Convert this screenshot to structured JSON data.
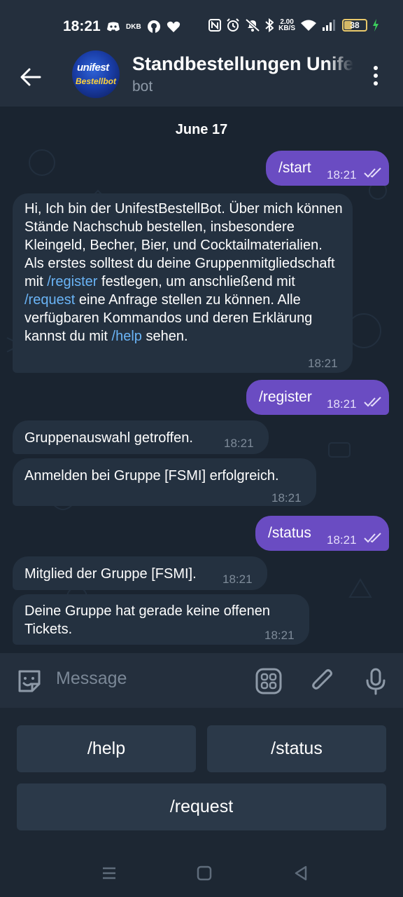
{
  "status_bar": {
    "time": "18:21",
    "carrier_label": "DKB",
    "net_speed_value": "2.00",
    "net_speed_unit": "KB/S",
    "battery": "38"
  },
  "header": {
    "title": "Standbestellungen Unifest",
    "subtitle": "bot",
    "avatar_text_top": "unifest",
    "avatar_text_bottom": "Bestellbot"
  },
  "chat": {
    "date": "June 17",
    "messages": [
      {
        "dir": "out",
        "text": "/start",
        "time": "18:21"
      },
      {
        "dir": "in",
        "time": "18:21",
        "parts": [
          "Hi, Ich bin der UnifestBestellBot. Über mich können Stände Nachschub bestellen, insbesondere Kleingeld, Becher, Bier, und Cocktailmaterialien. Als erstes solltest du deine Gruppenmitgliedschaft mit ",
          "/register",
          " festlegen, um anschließend mit ",
          "/request",
          " eine Anfrage stellen zu können. Alle verfügbaren Kommandos und deren Erklärung kannst du mit ",
          "/help",
          " sehen."
        ]
      },
      {
        "dir": "out",
        "text": "/register",
        "time": "18:21"
      },
      {
        "dir": "in",
        "text": "Gruppenauswahl getroffen.",
        "time": "18:21"
      },
      {
        "dir": "in",
        "text": "Anmelden bei Gruppe [FSMI] erfolgreich.",
        "time": "18:21"
      },
      {
        "dir": "out",
        "text": "/status",
        "time": "18:21"
      },
      {
        "dir": "in",
        "text": "Mitglied der Gruppe [FSMI].",
        "time": "18:21"
      },
      {
        "dir": "in",
        "text": "Deine Gruppe hat gerade keine offenen Tickets.",
        "time": "18:21"
      }
    ]
  },
  "composer": {
    "placeholder": "Message"
  },
  "bot_keyboard": {
    "buttons": [
      "/help",
      "/status",
      "/request"
    ]
  },
  "colors": {
    "outgoing_bubble": "#6a4cc2",
    "incoming_bubble": "#243140",
    "link": "#6ab4f6",
    "header_bg": "#242f3d",
    "chat_bg": "#1a2430"
  },
  "icons": {
    "back": "arrow-left-icon",
    "menu": "more-vert-icon",
    "emoji": "sticker-smile-icon",
    "keyboard": "bot-keyboard-icon",
    "attach": "paperclip-icon",
    "mic": "microphone-icon",
    "read": "double-check-icon"
  }
}
